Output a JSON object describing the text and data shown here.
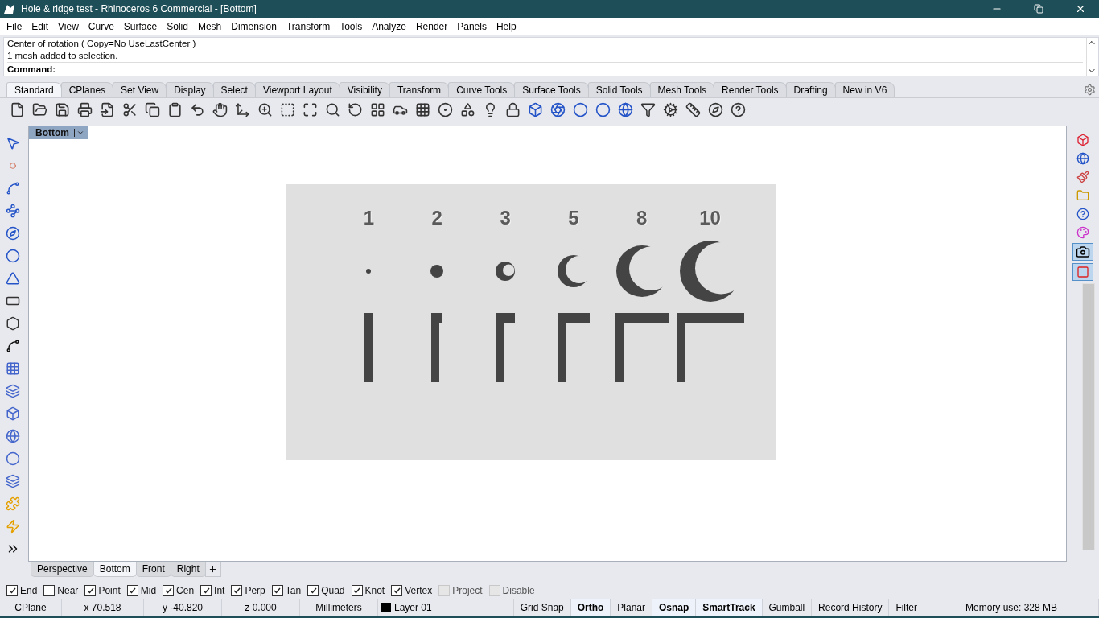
{
  "window": {
    "title": "Hole & ridge test - Rhinoceros 6 Commercial - [Bottom]"
  },
  "menu": [
    "File",
    "Edit",
    "View",
    "Curve",
    "Surface",
    "Solid",
    "Mesh",
    "Dimension",
    "Transform",
    "Tools",
    "Analyze",
    "Render",
    "Panels",
    "Help"
  ],
  "command_history": [
    "Center of rotation ( Copy=No  UseLastCenter )",
    "1 mesh added to selection."
  ],
  "command_prompt": "Command:",
  "toolbar_tabs": [
    {
      "label": "Standard",
      "selected": true
    },
    {
      "label": "CPlanes",
      "selected": false
    },
    {
      "label": "Set View",
      "selected": false
    },
    {
      "label": "Display",
      "selected": false
    },
    {
      "label": "Select",
      "selected": false
    },
    {
      "label": "Viewport Layout",
      "selected": false
    },
    {
      "label": "Visibility",
      "selected": false
    },
    {
      "label": "Transform",
      "selected": false
    },
    {
      "label": "Curve Tools",
      "selected": false
    },
    {
      "label": "Surface Tools",
      "selected": false
    },
    {
      "label": "Solid Tools",
      "selected": false
    },
    {
      "label": "Mesh Tools",
      "selected": false
    },
    {
      "label": "Render Tools",
      "selected": false
    },
    {
      "label": "Drafting",
      "selected": false
    },
    {
      "label": "New in V6",
      "selected": false
    }
  ],
  "viewport": {
    "title": "Bottom",
    "labels": [
      "1",
      "2",
      "3",
      "5",
      "8",
      "10"
    ]
  },
  "viewport_tabs": [
    {
      "label": "Perspective",
      "selected": false
    },
    {
      "label": "Bottom",
      "selected": true
    },
    {
      "label": "Front",
      "selected": false
    },
    {
      "label": "Right",
      "selected": false
    }
  ],
  "osnaps": [
    {
      "label": "End",
      "checked": true,
      "disabled": false
    },
    {
      "label": "Near",
      "checked": false,
      "disabled": false
    },
    {
      "label": "Point",
      "checked": true,
      "disabled": false
    },
    {
      "label": "Mid",
      "checked": true,
      "disabled": false
    },
    {
      "label": "Cen",
      "checked": true,
      "disabled": false
    },
    {
      "label": "Int",
      "checked": true,
      "disabled": false
    },
    {
      "label": "Perp",
      "checked": true,
      "disabled": false
    },
    {
      "label": "Tan",
      "checked": true,
      "disabled": false
    },
    {
      "label": "Quad",
      "checked": true,
      "disabled": false
    },
    {
      "label": "Knot",
      "checked": true,
      "disabled": false
    },
    {
      "label": "Vertex",
      "checked": true,
      "disabled": false
    },
    {
      "label": "Project",
      "checked": false,
      "disabled": true
    },
    {
      "label": "Disable",
      "checked": false,
      "disabled": true
    }
  ],
  "status_bar": {
    "cplane": "CPlane",
    "x": "x 70.518",
    "y": "y -40.820",
    "z": "z 0.000",
    "units": "Millimeters",
    "layer": "Layer 01",
    "toggles": [
      {
        "label": "Grid Snap",
        "on": false
      },
      {
        "label": "Ortho",
        "on": true
      },
      {
        "label": "Planar",
        "on": false
      },
      {
        "label": "Osnap",
        "on": true
      },
      {
        "label": "SmartTrack",
        "on": true
      },
      {
        "label": "Gumball",
        "on": false
      },
      {
        "label": "Record History",
        "on": false
      },
      {
        "label": "Filter",
        "on": false
      }
    ],
    "memory": "Memory use: 328 MB"
  }
}
